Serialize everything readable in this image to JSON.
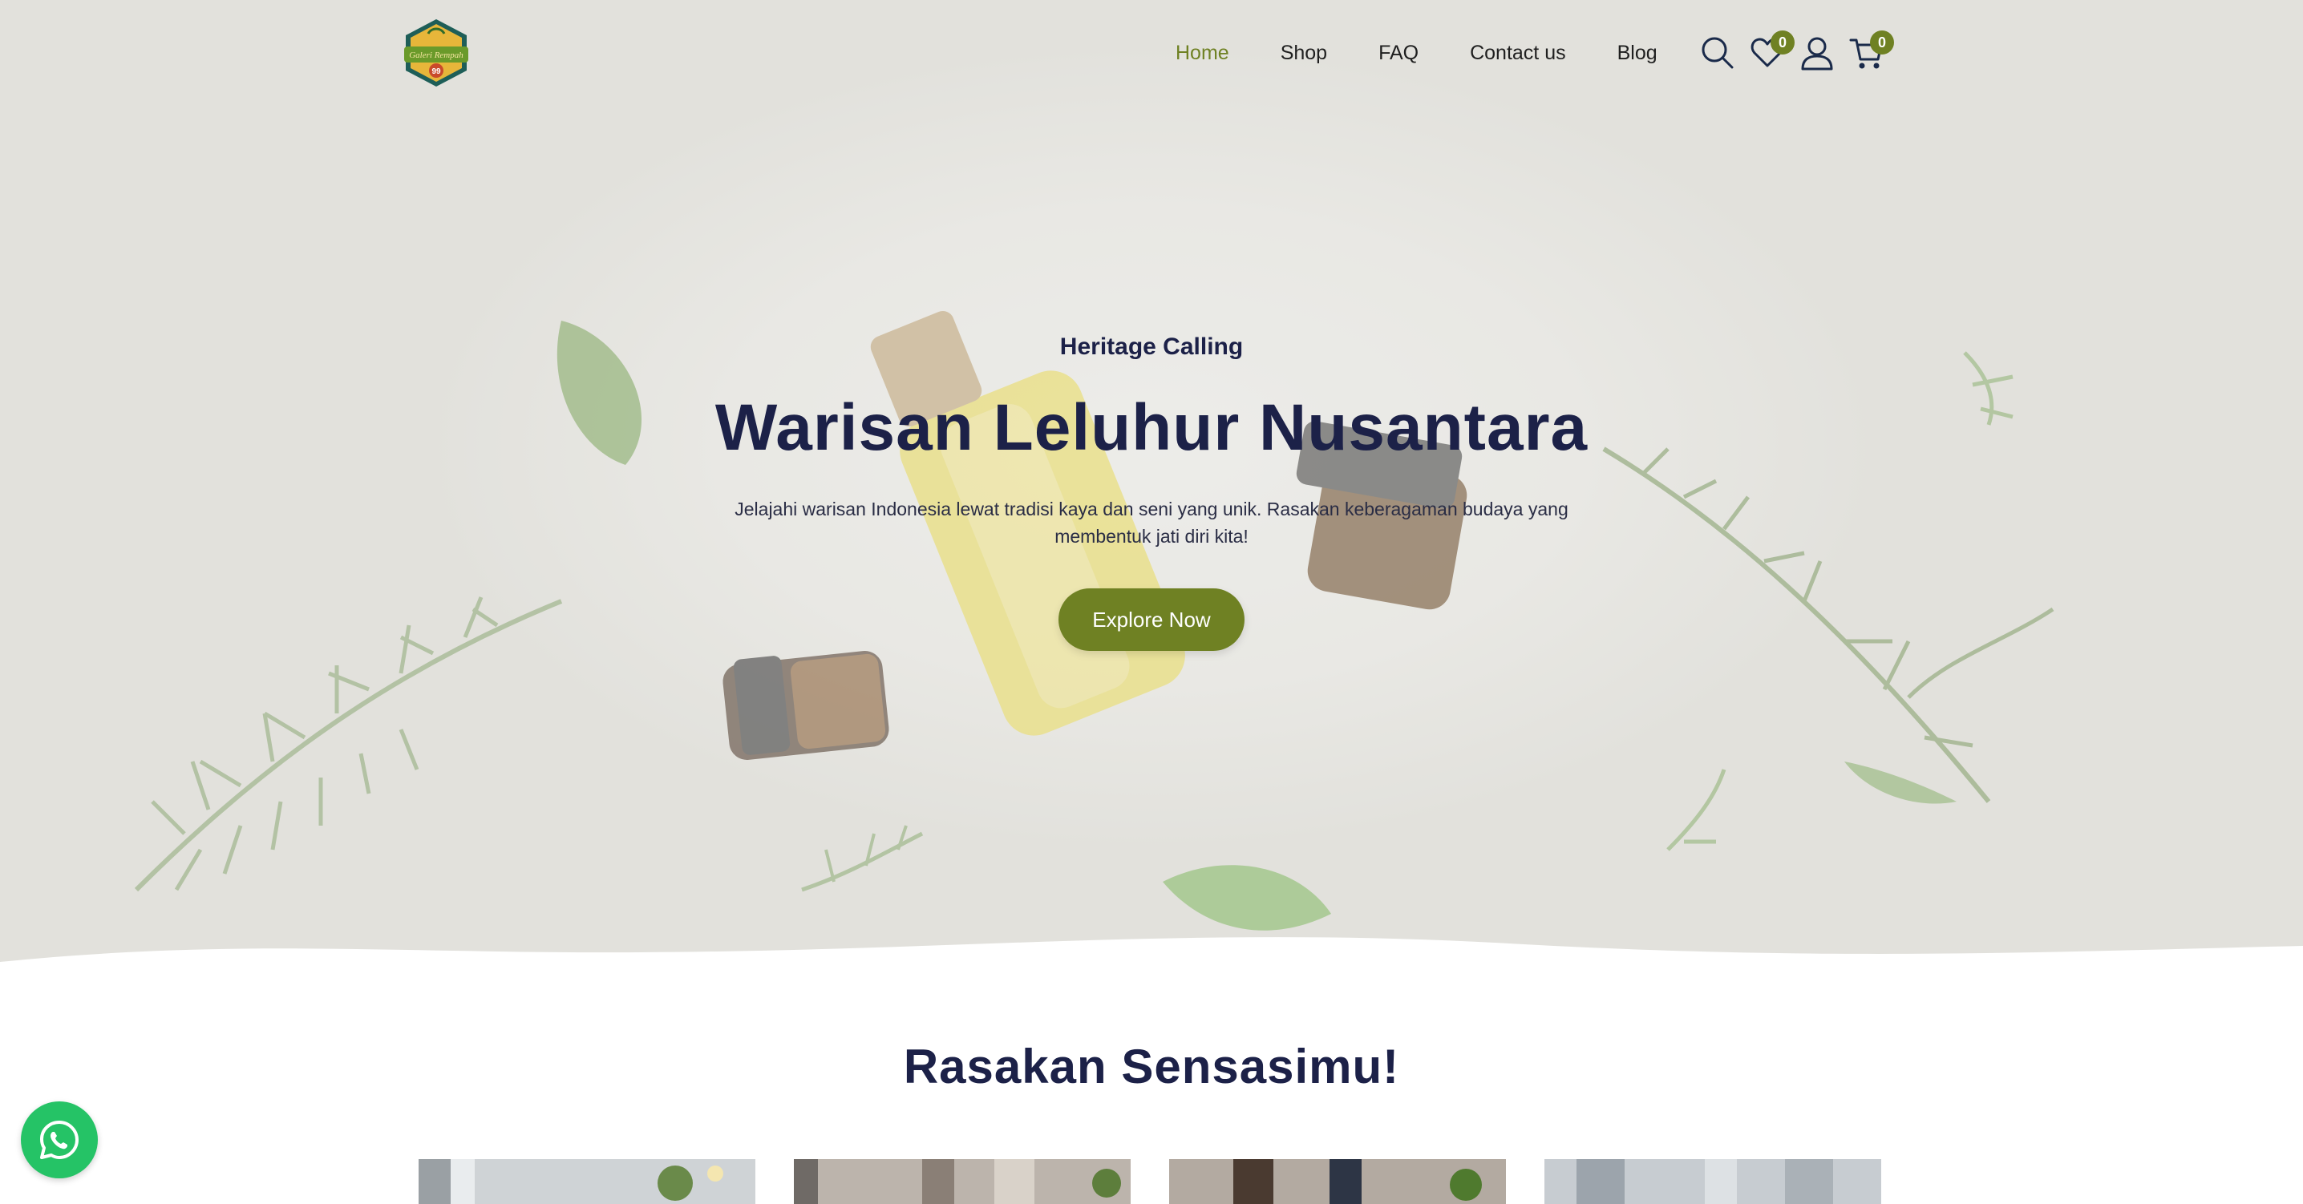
{
  "header": {
    "logo_text": "Galeri Rempah 99",
    "nav": [
      {
        "label": "Home",
        "active": true
      },
      {
        "label": "Shop",
        "active": false
      },
      {
        "label": "FAQ",
        "active": false
      },
      {
        "label": "Contact us",
        "active": false
      },
      {
        "label": "Blog",
        "active": false
      }
    ],
    "icons": {
      "search": "search-icon",
      "wishlist": "heart-icon",
      "account": "user-icon",
      "cart": "cart-icon"
    },
    "wishlist_count": "0",
    "cart_count": "0"
  },
  "hero": {
    "eyebrow": "Heritage Calling",
    "title": "Warisan Leluhur Nusantara",
    "description": "Jelajahi warisan Indonesia lewat tradisi kaya dan seni yang unik. Rasakan keberagaman budaya yang membentuk jati diri kita!",
    "cta_label": "Explore Now"
  },
  "section": {
    "title": "Rasakan Sensasimu!",
    "cards_visible": 4
  },
  "floating": {
    "whatsapp_icon": "whatsapp-icon"
  },
  "colors": {
    "accent": "#6f8123",
    "heading": "#1c2148",
    "whatsapp": "#25c366"
  }
}
